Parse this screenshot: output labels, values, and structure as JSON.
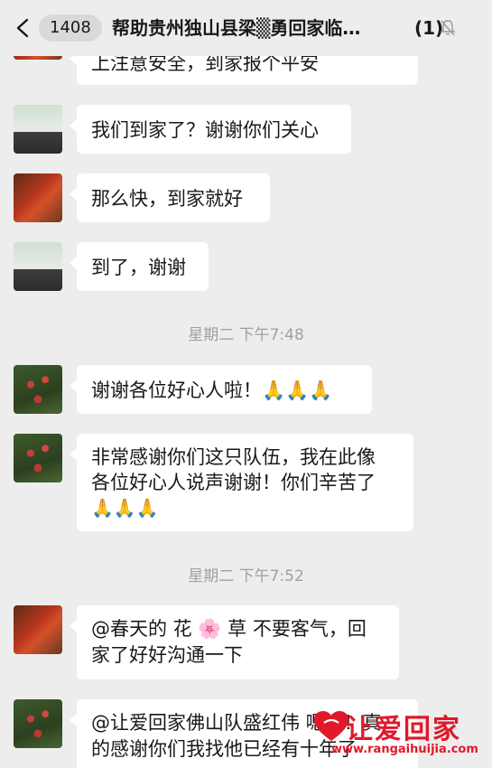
{
  "header": {
    "unread_count": "1408",
    "title": "帮助贵州独山县梁▒勇回家临…",
    "member_count": "(1)"
  },
  "messages": [
    {
      "text": "上注意安全，到家报个平安"
    },
    {
      "text": "我们到家了？谢谢你们关心"
    },
    {
      "text": "那么快，到家就好"
    },
    {
      "text": "到了，谢谢"
    },
    {
      "text": "谢谢各位好心人啦！🙏🙏🙏"
    },
    {
      "line1": "非常感谢你们这只队伍，我在此像",
      "line2": "各位好心人说声谢谢！你们辛苦了",
      "line3": "🙏🙏🙏"
    },
    {
      "line1": "@春天的 花 🌸 草 不要客气，回",
      "line2": "家了好好沟通一下"
    },
    {
      "line1": "@让爱回家佛山队盛红伟 嗯嗯！真",
      "line2": "的感谢你们我找他已经有十年了"
    }
  ],
  "timestamps": [
    "星期二 下午7:48",
    "星期二 下午7:52"
  ],
  "watermark": {
    "title": "让爱回家",
    "url": "www.rangaihuijia.com"
  },
  "colors": {
    "background": "#ededed",
    "bubble": "#ffffff",
    "timestamp_text": "#a0a0a0",
    "watermark_red": "#e0192a"
  }
}
